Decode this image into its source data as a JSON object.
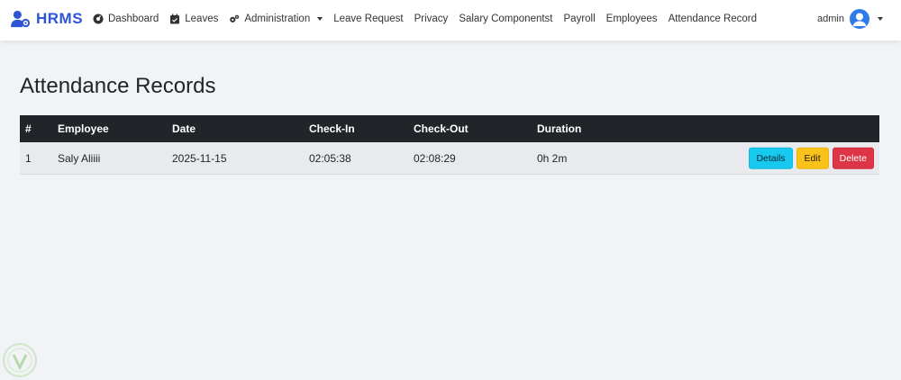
{
  "brand": {
    "name": "HRMS",
    "icon": "user-gear-icon",
    "color": "#2f55d4"
  },
  "nav": {
    "items": [
      {
        "label": "Dashboard",
        "icon": "dashboard-gauge-icon"
      },
      {
        "label": "Leaves",
        "icon": "calendar-check-icon"
      },
      {
        "label": "Administration",
        "icon": "gears-icon",
        "dropdown": true
      },
      {
        "label": "Leave Request"
      },
      {
        "label": "Privacy"
      },
      {
        "label": "Salary Componentst"
      },
      {
        "label": "Payroll"
      },
      {
        "label": "Employees"
      },
      {
        "label": "Attendance Record"
      }
    ]
  },
  "user": {
    "name": "admin",
    "icon": "user-avatar-icon",
    "dropdown": true
  },
  "page": {
    "title": "Attendance Records"
  },
  "table": {
    "headers": [
      "#",
      "Employee",
      "Date",
      "Check-In",
      "Check-Out",
      "Duration"
    ],
    "rows": [
      {
        "num": "1",
        "employee": "Saly Aliiii",
        "date": "2025-11-15",
        "check_in": "02:05:38",
        "check_out": "02:08:29",
        "duration": "0h 2m",
        "actions": {
          "details": "Details",
          "edit": "Edit",
          "delete": "Delete"
        }
      }
    ]
  },
  "colors": {
    "header_bg": "#212529",
    "details": "#18c9ef",
    "edit": "#fbc31a",
    "delete": "#dd3545"
  }
}
